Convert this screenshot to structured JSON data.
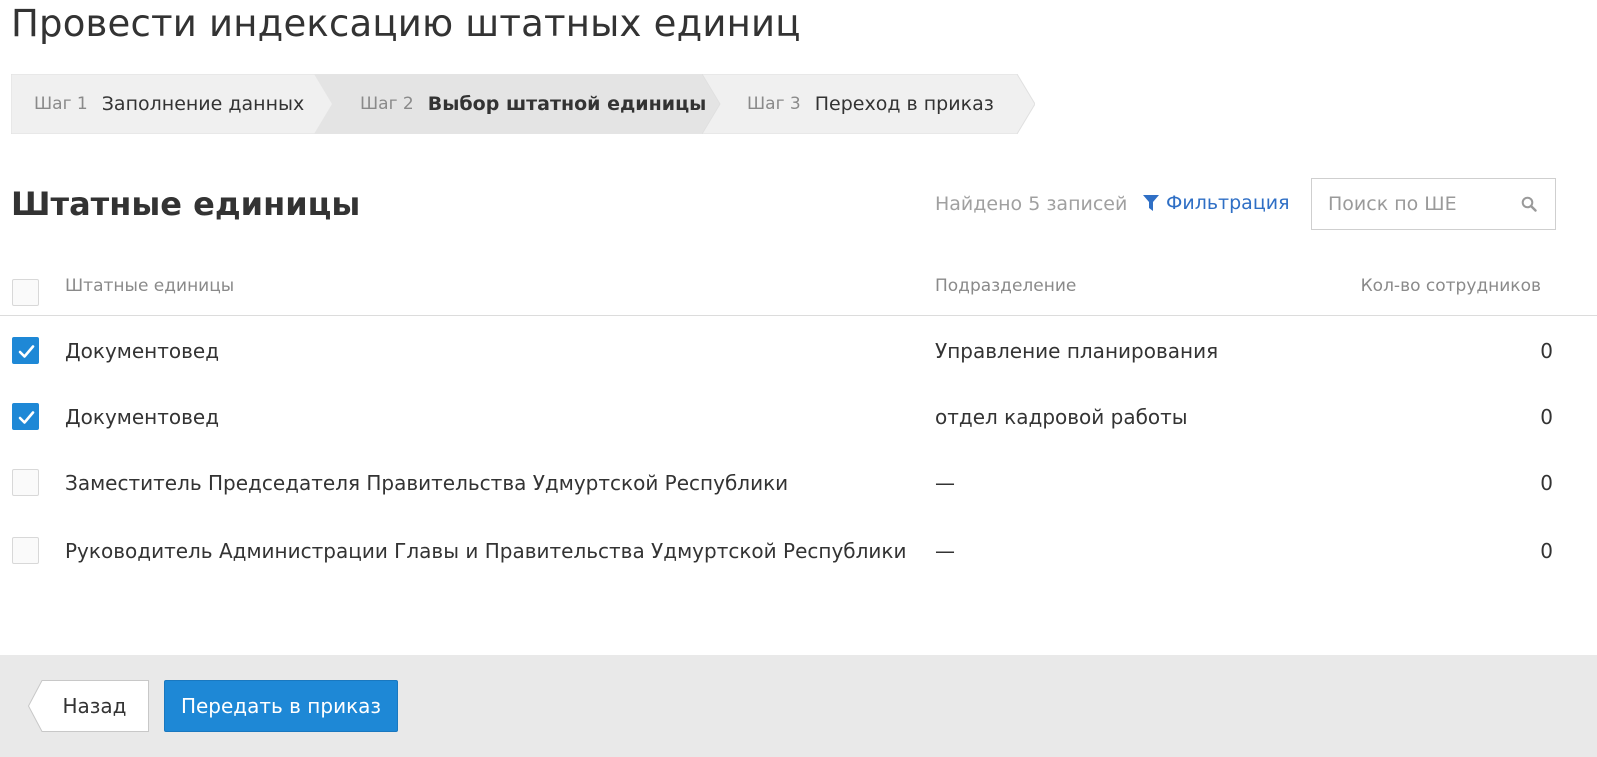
{
  "page": {
    "title": "Провести индексацию штатных единиц"
  },
  "stepper": {
    "steps": [
      {
        "num": "Шаг 1",
        "label": "Заполнение данных",
        "active": false
      },
      {
        "num": "Шаг 2",
        "label": "Выбор штатной единицы",
        "active": true
      },
      {
        "num": "Шаг 3",
        "label": "Переход в приказ",
        "active": false
      }
    ]
  },
  "section": {
    "title": "Штатные единицы",
    "found_text": "Найдено 5 записей",
    "filter_label": "Фильтрация",
    "search_placeholder": "Поиск по ШЕ"
  },
  "table": {
    "columns": [
      "Штатные единицы",
      "Подразделение",
      "Кол-во сотрудников"
    ],
    "rows": [
      {
        "checked": true,
        "name": "Документовед",
        "dept": "Управление планирования",
        "count": "0"
      },
      {
        "checked": true,
        "name": "Документовед",
        "dept": "отдел кадровой работы",
        "count": "0"
      },
      {
        "checked": false,
        "name": "Заместитель Председателя Правительства Удмуртской Республики",
        "dept": "—",
        "count": "0"
      },
      {
        "checked": false,
        "name": "Руководитель Администрации Главы и Правительства Удмуртской Республики",
        "dept": "—",
        "count": "0"
      }
    ]
  },
  "footer": {
    "back_label": "Назад",
    "submit_label": "Передать в приказ"
  },
  "colors": {
    "accent": "#1e88d6",
    "link": "#2f6fc5",
    "step_active_bg": "#e4e4e4",
    "step_bg": "#f0f0f0"
  },
  "icons": {
    "filter": "filter-icon",
    "search": "search-icon",
    "check": "checkmark-icon"
  }
}
